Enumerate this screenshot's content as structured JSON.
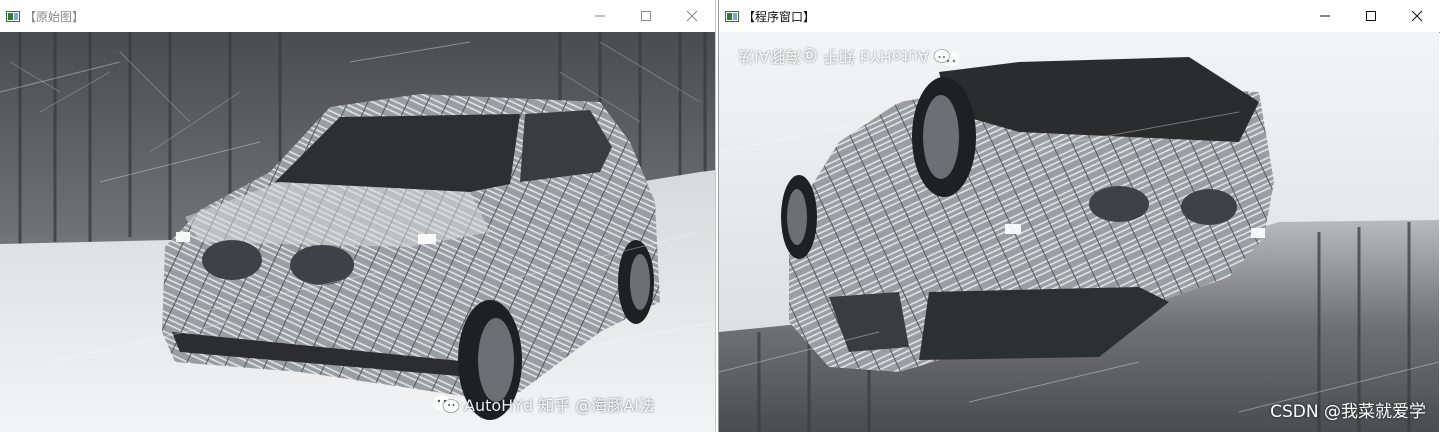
{
  "windows": {
    "original": {
      "title": "【原始图】",
      "controls": [
        "minimize",
        "maximize",
        "close"
      ]
    },
    "program": {
      "title": "【程序窗口】",
      "controls": [
        "minimize",
        "maximize",
        "close"
      ]
    }
  },
  "images": {
    "original": {
      "watermark": "AutoHYd 知乎 @海豚AI法"
    },
    "program": {
      "watermark": "AutoHYd 知乎 @海豚AI法",
      "overlay_credit": "CSDN @我菜就爱学"
    }
  },
  "colors": {
    "snow": "#e9ebee",
    "forest": "#5a5d60",
    "car_body": "#8a8f94",
    "car_dark": "#2a2c2e",
    "titlebar_bg": "#ffffff"
  },
  "icons": {
    "app": "opencv-window-icon",
    "minimize": "minimize-icon",
    "maximize": "maximize-icon",
    "close": "close-icon",
    "wechat": "wechat-icon"
  }
}
